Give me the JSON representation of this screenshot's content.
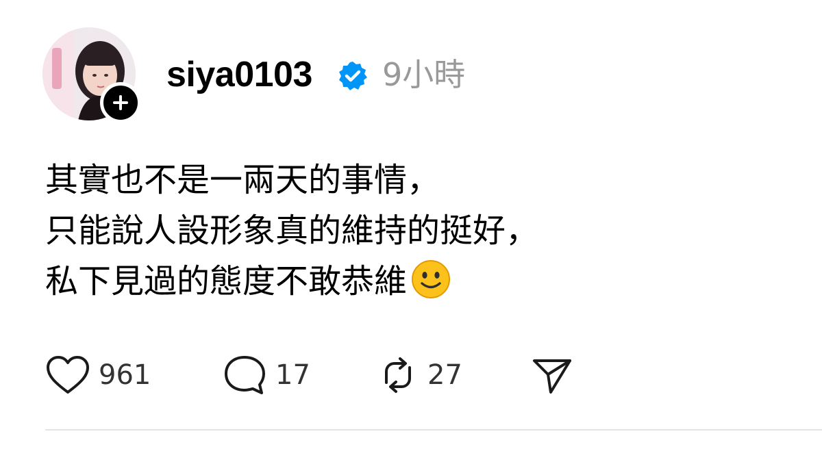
{
  "post": {
    "username": "siya0103",
    "verified": true,
    "timestamp": "9小時",
    "lines": [
      "其實也不是一兩天的事情，",
      "只能說人設形象真的維持的挺好，",
      "私下見過的態度不敢恭維"
    ],
    "trailing_emoji": "slightly-smiling-face",
    "actions": {
      "like_count": "961",
      "reply_count": "17",
      "repost_count": "27"
    }
  },
  "colors": {
    "text": "#000000",
    "muted": "#999999",
    "verified": "#0095f6",
    "divider": "#e3e3e3"
  }
}
